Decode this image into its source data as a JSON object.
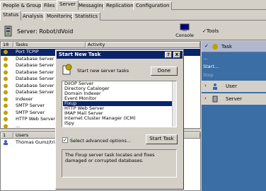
{
  "top_tabs": [
    "People & Groups",
    "Files",
    "Server",
    "Messaging",
    "Replication",
    "Configuration"
  ],
  "sub_tabs": [
    "Status",
    "Analysis",
    "Monitoring",
    "Statistics"
  ],
  "header": {
    "server_label": "Server: Robot/dVoid",
    "console_label": "Console",
    "tools_label": "Tools"
  },
  "grid": {
    "col_count": "18",
    "col_tasks": "Tasks",
    "col_activity": "Activity",
    "rows": [
      "Port TCPIP",
      "Database Server",
      "Database Server",
      "Database Server",
      "Database Server",
      "Database Server",
      "Database Server",
      "Indexer",
      "SMTP Server",
      "SMTP Server",
      "HTTP Web Server",
      "..."
    ]
  },
  "grid2": {
    "col_count": "1",
    "col_users": "Users",
    "col_ed": "ed",
    "rows": [
      "Thomas Gumz/tris"
    ]
  },
  "right_panel": {
    "task_label": "Task",
    "items": [
      "...",
      "Start...",
      "Stop"
    ],
    "user_label": "User",
    "server_label": "Server"
  },
  "dialog": {
    "title": "Start New Task",
    "help_btn": "?",
    "close_btn": "X",
    "instruction": "Start new server tasks",
    "done_label": "Done",
    "tasks": [
      "DIIOP Server",
      "Directory Cataloger",
      "Domain Indexer",
      "Event Monitor",
      "Fixup",
      "HTTP Web Server",
      "IMAP Mail Server",
      "Internet Cluster Manager (ICM)",
      "ISpy"
    ],
    "selected_index": 4,
    "advanced_label": "Select advanced options...",
    "advanced_checked": true,
    "start_label": "Start Task",
    "description": "The Fixup server task locates and fixes damaged or corrupted databases."
  }
}
